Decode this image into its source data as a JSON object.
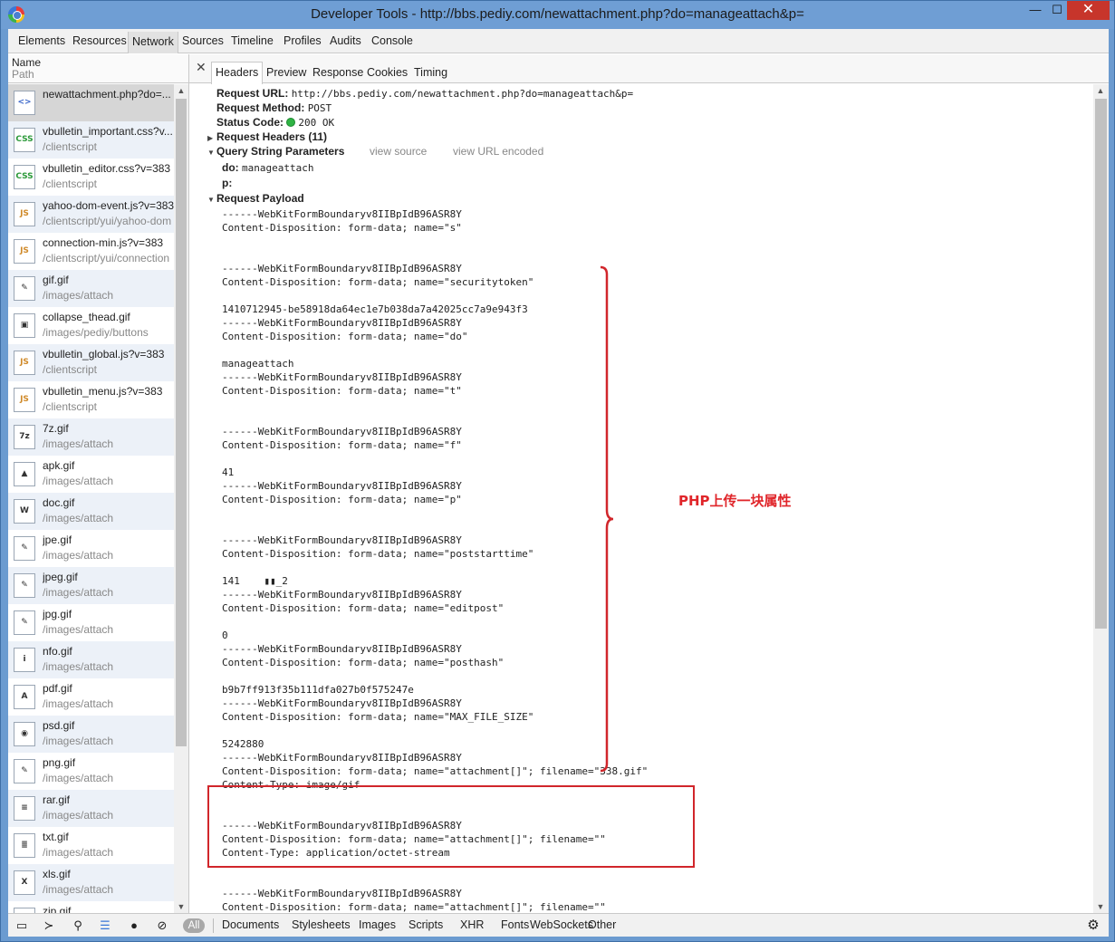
{
  "window": {
    "title": "Developer Tools - http://bbs.pediy.com/newattachment.php?do=manageattach&p=",
    "minimize": "—",
    "maximize": "☐",
    "close": "✕"
  },
  "top_tabs": [
    "Elements",
    "Resources",
    "Network",
    "Sources",
    "Timeline",
    "Profiles",
    "Audits",
    "Console"
  ],
  "active_top_tab": "Network",
  "left_panel": {
    "col_name": "Name",
    "col_path": "Path",
    "files": [
      {
        "name": "newattachment.php?do=...",
        "path": "",
        "icon": "html-icon",
        "glyph": "<>"
      },
      {
        "name": "vbulletin_important.css?v...",
        "path": "/clientscript",
        "icon": "css-icon",
        "glyph": "CSS"
      },
      {
        "name": "vbulletin_editor.css?v=383",
        "path": "/clientscript",
        "icon": "css-icon",
        "glyph": "CSS"
      },
      {
        "name": "yahoo-dom-event.js?v=383",
        "path": "/clientscript/yui/yahoo-dom",
        "icon": "js-icon",
        "glyph": "JS"
      },
      {
        "name": "connection-min.js?v=383",
        "path": "/clientscript/yui/connection",
        "icon": "js-icon",
        "glyph": "JS"
      },
      {
        "name": "gif.gif",
        "path": "/images/attach",
        "icon": "image-icon",
        "glyph": "✎"
      },
      {
        "name": "collapse_thead.gif",
        "path": "/images/pediy/buttons",
        "icon": "image-icon",
        "glyph": "▣"
      },
      {
        "name": "vbulletin_global.js?v=383",
        "path": "/clientscript",
        "icon": "js-icon",
        "glyph": "JS"
      },
      {
        "name": "vbulletin_menu.js?v=383",
        "path": "/clientscript",
        "icon": "js-icon",
        "glyph": "JS"
      },
      {
        "name": "7z.gif",
        "path": "/images/attach",
        "icon": "image-icon",
        "glyph": "7z"
      },
      {
        "name": "apk.gif",
        "path": "/images/attach",
        "icon": "image-icon",
        "glyph": "▲"
      },
      {
        "name": "doc.gif",
        "path": "/images/attach",
        "icon": "image-icon",
        "glyph": "W"
      },
      {
        "name": "jpe.gif",
        "path": "/images/attach",
        "icon": "image-icon",
        "glyph": "✎"
      },
      {
        "name": "jpeg.gif",
        "path": "/images/attach",
        "icon": "image-icon",
        "glyph": "✎"
      },
      {
        "name": "jpg.gif",
        "path": "/images/attach",
        "icon": "image-icon",
        "glyph": "✎"
      },
      {
        "name": "nfo.gif",
        "path": "/images/attach",
        "icon": "image-icon",
        "glyph": "i"
      },
      {
        "name": "pdf.gif",
        "path": "/images/attach",
        "icon": "image-icon",
        "glyph": "A"
      },
      {
        "name": "psd.gif",
        "path": "/images/attach",
        "icon": "image-icon",
        "glyph": "◉"
      },
      {
        "name": "png.gif",
        "path": "/images/attach",
        "icon": "image-icon",
        "glyph": "✎"
      },
      {
        "name": "rar.gif",
        "path": "/images/attach",
        "icon": "image-icon",
        "glyph": "≡"
      },
      {
        "name": "txt.gif",
        "path": "/images/attach",
        "icon": "image-icon",
        "glyph": "≣"
      },
      {
        "name": "xls.gif",
        "path": "/images/attach",
        "icon": "image-icon",
        "glyph": "X"
      },
      {
        "name": "zip.gif",
        "path": "",
        "icon": "image-icon",
        "glyph": "Z"
      }
    ]
  },
  "detail_tabs": [
    "Headers",
    "Preview",
    "Response",
    "Cookies",
    "Timing"
  ],
  "active_detail_tab": "Headers",
  "headers": {
    "request_url_label": "Request URL:",
    "request_url": "http://bbs.pediy.com/newattachment.php?do=manageattach&p=",
    "request_method_label": "Request Method:",
    "request_method": "POST",
    "status_code_label": "Status Code:",
    "status_code": "200 OK",
    "request_headers": "Request Headers (11)",
    "query_string_params": "Query String Parameters",
    "view_source": "view source",
    "view_url_encoded": "view URL encoded",
    "param_do_key": "do:",
    "param_do_val": "manageattach",
    "param_p_key": "p:",
    "request_payload": "Request Payload"
  },
  "payload_lines": [
    "------WebKitFormBoundaryv8IIBpIdB96ASR8Y",
    "Content-Disposition: form-data; name=\"s\"",
    "",
    "",
    "------WebKitFormBoundaryv8IIBpIdB96ASR8Y",
    "Content-Disposition: form-data; name=\"securitytoken\"",
    "",
    "1410712945-be58918da64ec1e7b038da7a42025cc7a9e943f3",
    "------WebKitFormBoundaryv8IIBpIdB96ASR8Y",
    "Content-Disposition: form-data; name=\"do\"",
    "",
    "manageattach",
    "------WebKitFormBoundaryv8IIBpIdB96ASR8Y",
    "Content-Disposition: form-data; name=\"t\"",
    "",
    "",
    "------WebKitFormBoundaryv8IIBpIdB96ASR8Y",
    "Content-Disposition: form-data; name=\"f\"",
    "",
    "41",
    "------WebKitFormBoundaryv8IIBpIdB96ASR8Y",
    "Content-Disposition: form-data; name=\"p\"",
    "",
    "",
    "------WebKitFormBoundaryv8IIBpIdB96ASR8Y",
    "Content-Disposition: form-data; name=\"poststarttime\"",
    "",
    "141    ▮▮_2",
    "------WebKitFormBoundaryv8IIBpIdB96ASR8Y",
    "Content-Disposition: form-data; name=\"editpost\"",
    "",
    "0",
    "------WebKitFormBoundaryv8IIBpIdB96ASR8Y",
    "Content-Disposition: form-data; name=\"posthash\"",
    "",
    "b9b7ff913f35b111dfa027b0f575247e",
    "------WebKitFormBoundaryv8IIBpIdB96ASR8Y",
    "Content-Disposition: form-data; name=\"MAX_FILE_SIZE\"",
    "",
    "5242880",
    "------WebKitFormBoundaryv8IIBpIdB96ASR8Y",
    "Content-Disposition: form-data; name=\"attachment[]\"; filename=\"338.gif\"",
    "Content-Type: image/gif",
    "",
    "",
    "------WebKitFormBoundaryv8IIBpIdB96ASR8Y",
    "Content-Disposition: form-data; name=\"attachment[]\"; filename=\"\"",
    "Content-Type: application/octet-stream",
    "",
    "",
    "------WebKitFormBoundaryv8IIBpIdB96ASR8Y",
    "Content-Disposition: form-data; name=\"attachment[]\"; filename=\"\""
  ],
  "annotation": "PHP上传一块属性",
  "annotation_color": "#e0252a",
  "bottom_filters": {
    "all": "All",
    "items": [
      "Documents",
      "Stylesheets",
      "Images",
      "Scripts",
      "XHR",
      "Fonts",
      "WebSockets",
      "Other"
    ]
  }
}
